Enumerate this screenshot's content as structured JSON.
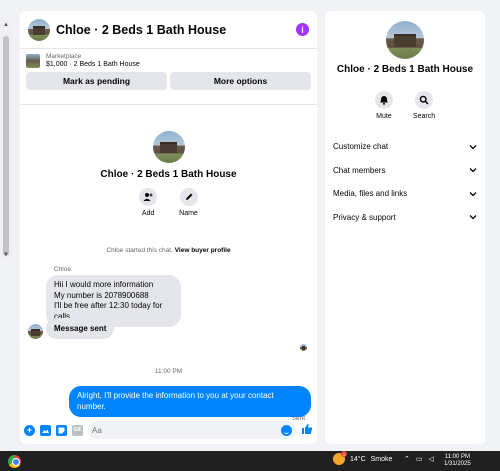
{
  "chat": {
    "title": "Chloe · 2 Beds 1 Bath House",
    "marketplace": {
      "label": "Marketplace",
      "price_title": "$1,000 · 2 Beds 1 Bath House",
      "buttons": [
        "Mark as pending",
        "More options"
      ]
    },
    "profile": {
      "name": "Chloe · 2 Beds 1 Bath House",
      "actions": [
        {
          "label": "Add",
          "icon": "add-person-icon"
        },
        {
          "label": "Name",
          "icon": "pencil-icon"
        }
      ]
    },
    "started_text": "Chloe started this chat.",
    "view_profile": "View buyer profile",
    "sender_name": "Chloe",
    "messages": {
      "in1_line1": "Hii I would more information",
      "in1_line2": "My number is 2078900688",
      "in1_line3": "I'll be free after 12:30 today for calls",
      "in2": "Message sent",
      "time_separator": "11:00 PM",
      "out1": "Alright, I'll provide the information to you at your contact number.",
      "status": "Sent"
    },
    "composer": {
      "placeholder": "Aa"
    }
  },
  "info_panel": {
    "name": "Chloe · 2 Beds 1 Bath House",
    "actions": [
      {
        "label": "Mute",
        "icon": "bell-icon"
      },
      {
        "label": "Search",
        "icon": "search-icon"
      }
    ],
    "menu": [
      "Customize chat",
      "Chat members",
      "Media, files and links",
      "Privacy & support"
    ]
  },
  "taskbar": {
    "weather_badge": "1",
    "temperature": "14°C",
    "condition": "Smoke",
    "time": "11:00 PM",
    "date": "1/31/2025"
  },
  "colors": {
    "accent": "#0084ff",
    "info": "#a033ff",
    "bubble_in": "#e4e6eb",
    "background": "#f0f2f5"
  }
}
